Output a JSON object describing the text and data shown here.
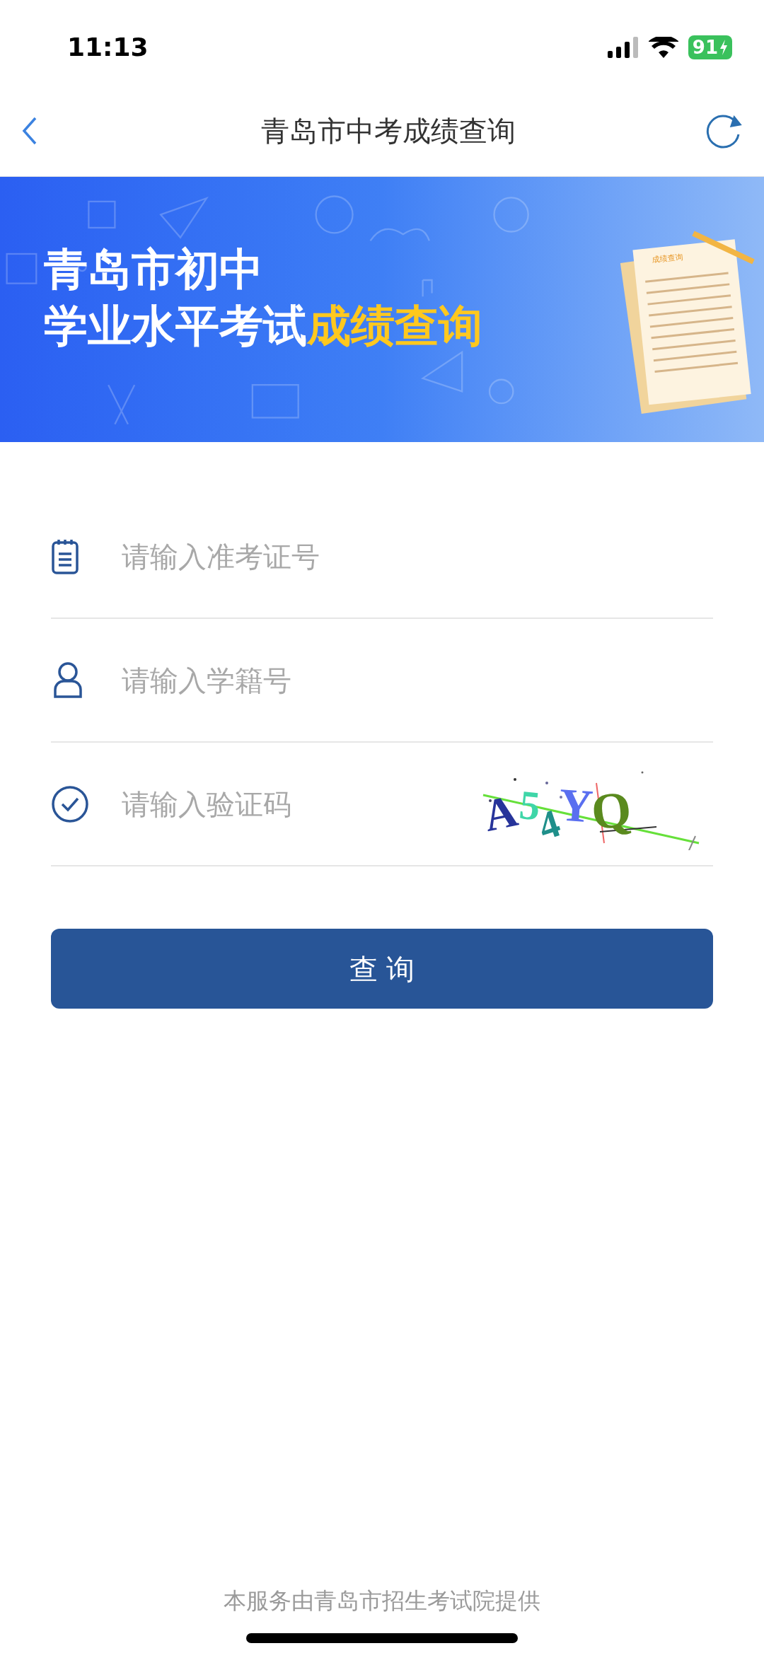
{
  "status_bar": {
    "time": "11:13",
    "battery": "91"
  },
  "nav": {
    "title": "青岛市中考成绩查询"
  },
  "banner": {
    "line_1": "青岛市初中",
    "line_2_plain": "学业水平考试",
    "line_2_highlight": "成绩查询",
    "paper_title": "成绩查询"
  },
  "fields": [
    {
      "kind": "ticket",
      "placeholder": "请输入准考证号"
    },
    {
      "kind": "student",
      "placeholder": "请输入学籍号"
    },
    {
      "kind": "captcha",
      "placeholder": "请输入验证码",
      "captcha": "A54YQ"
    }
  ],
  "submit_button": "查 询",
  "footer": "本服务由青岛市招生考试院提供"
}
